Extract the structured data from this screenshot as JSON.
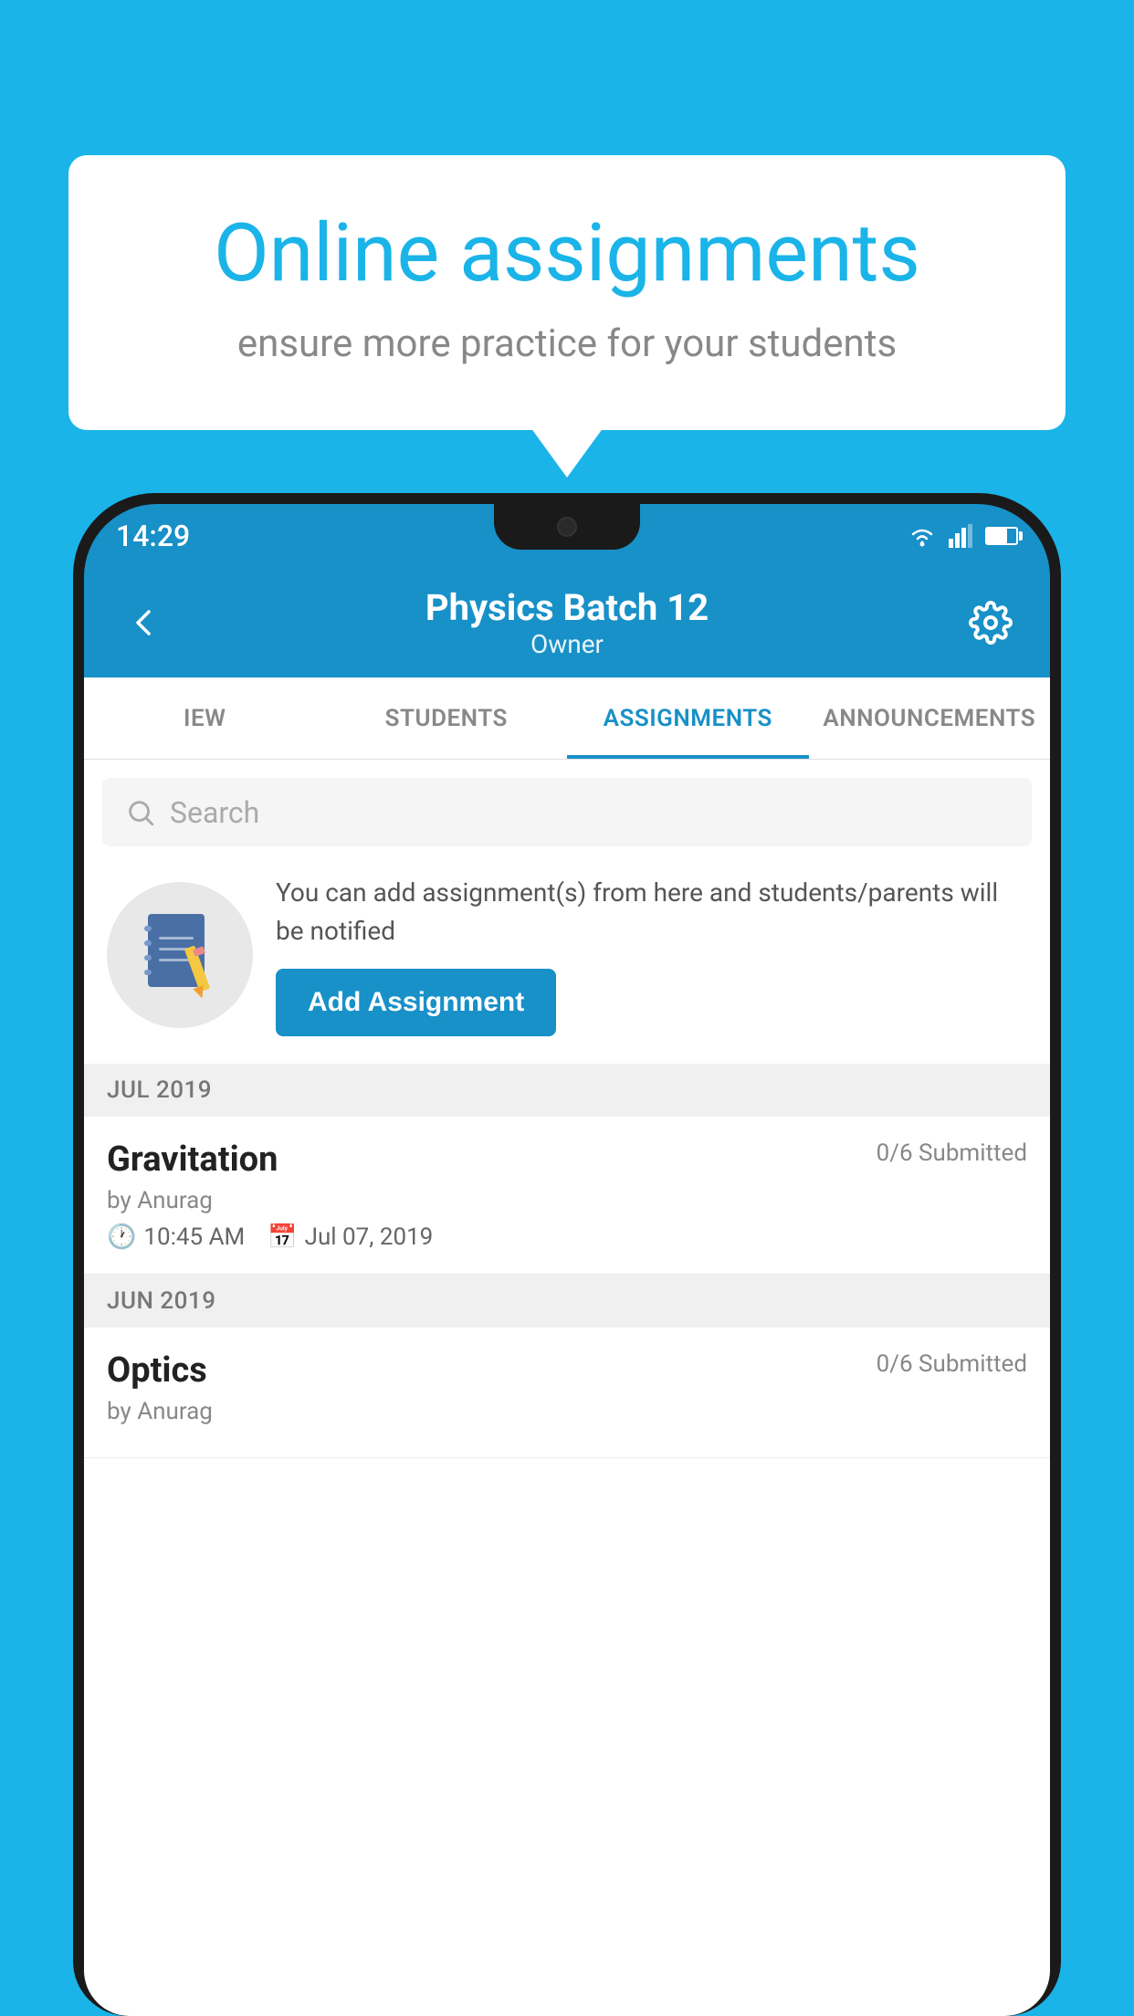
{
  "background_color": "#1ab4e8",
  "speech_bubble": {
    "title": "Online assignments",
    "subtitle": "ensure more practice for your students"
  },
  "phone": {
    "status_bar": {
      "time": "14:29"
    },
    "header": {
      "title": "Physics Batch 12",
      "subtitle": "Owner",
      "back_label": "←",
      "settings_label": "⚙"
    },
    "tabs": [
      {
        "label": "IEW",
        "active": false
      },
      {
        "label": "STUDENTS",
        "active": false
      },
      {
        "label": "ASSIGNMENTS",
        "active": true
      },
      {
        "label": "ANNOUNCEMENTS",
        "active": false
      }
    ],
    "search": {
      "placeholder": "Search"
    },
    "promo": {
      "description": "You can add assignment(s) from here and students/parents will be notified",
      "button_label": "Add Assignment"
    },
    "sections": [
      {
        "month": "JUL 2019",
        "assignments": [
          {
            "title": "Gravitation",
            "submitted": "0/6 Submitted",
            "by": "by Anurag",
            "time": "10:45 AM",
            "date": "Jul 07, 2019"
          }
        ]
      },
      {
        "month": "JUN 2019",
        "assignments": [
          {
            "title": "Optics",
            "submitted": "0/6 Submitted",
            "by": "by Anurag",
            "time": "",
            "date": ""
          }
        ]
      }
    ]
  }
}
